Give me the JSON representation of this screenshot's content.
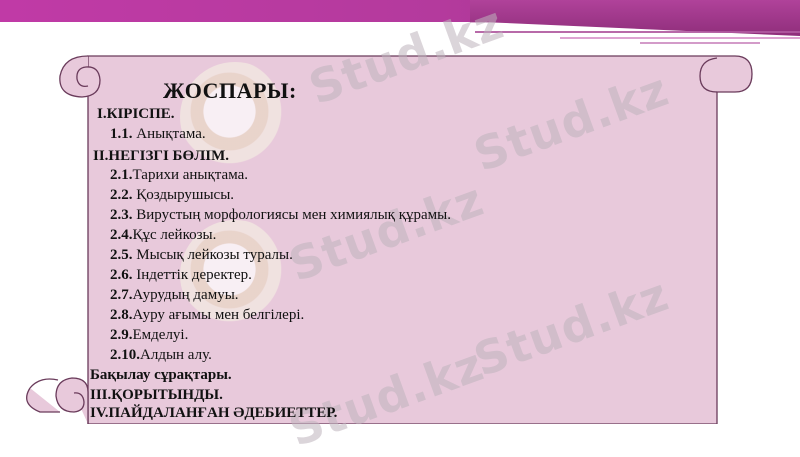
{
  "title": "ЖОСПАРЫ:",
  "watermark": "Stud.kz",
  "items": [
    {
      "num": "",
      "text": "I.КІРІСПЕ."
    },
    {
      "num": "1.1.",
      "text": " Анықтама."
    },
    {
      "num": "",
      "text": "II.НЕГІЗГІ БӨЛІМ."
    },
    {
      "num": "2.1.",
      "text": "Тарихи анықтама."
    },
    {
      "num": "2.2.",
      "text": " Қоздырушысы."
    },
    {
      "num": "2.3.",
      "text": " Вирустың морфологиясы мен химиялық құрамы."
    },
    {
      "num": "2.4.",
      "text": "Құс лейкозы."
    },
    {
      "num": "2.5.",
      "text": " Мысық лейкозы туралы."
    },
    {
      "num": "2.6.",
      "text": " Індеттік деректер."
    },
    {
      "num": "2.7.",
      "text": "Аурудың дамуы."
    },
    {
      "num": "2.8.",
      "text": "Ауру ағымы мен белгілері."
    },
    {
      "num": "2.9.",
      "text": "Емделуі."
    },
    {
      "num": "2.10.",
      "text": "Алдын алу."
    },
    {
      "num": "",
      "text": "Бақылау сұрақтары."
    },
    {
      "num": "",
      "text": "III.ҚОРЫТЫНДЫ."
    },
    {
      "num": "",
      "text": "IV.ПАЙДАЛАНҒАН ӘДЕБИЕТТЕР."
    }
  ],
  "colors": {
    "band": "#b43a9d",
    "scroll_fill": "#e8c9db",
    "scroll_stroke": "#6a3b5b"
  }
}
